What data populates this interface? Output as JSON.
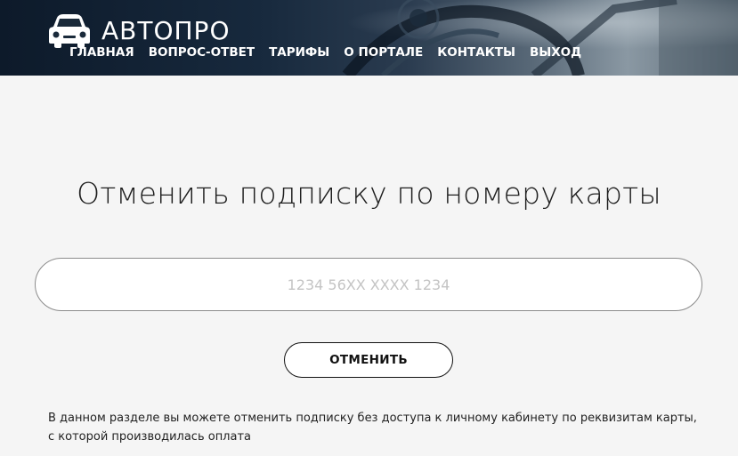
{
  "brand": {
    "name": "АВТОПРО",
    "icon": "car-icon"
  },
  "nav": {
    "items": [
      {
        "label": "ГЛАВНАЯ"
      },
      {
        "label": "ВОПРОС-ОТВЕТ"
      },
      {
        "label": "ТАРИФЫ"
      },
      {
        "label": "О ПОРТАЛЕ"
      },
      {
        "label": "КОНТАКТЫ"
      },
      {
        "label": "ВЫХОД"
      }
    ]
  },
  "main": {
    "title": "Отменить подписку по номеру карты",
    "card_input": {
      "value": "",
      "placeholder": "1234 56XX XXXX 1234"
    },
    "cancel_label": "ОТМЕНИТЬ",
    "info_text": "В данном разделе вы можете отменить подписку без доступа к личному кабинету по реквизитам карты, с которой производилась оплата"
  },
  "colors": {
    "header_dark": "#0d1a2a",
    "page_background": "#f5f5f5",
    "text_dark": "#1e1e1e",
    "placeholder": "#c4c4c4",
    "button_border": "#111111"
  }
}
